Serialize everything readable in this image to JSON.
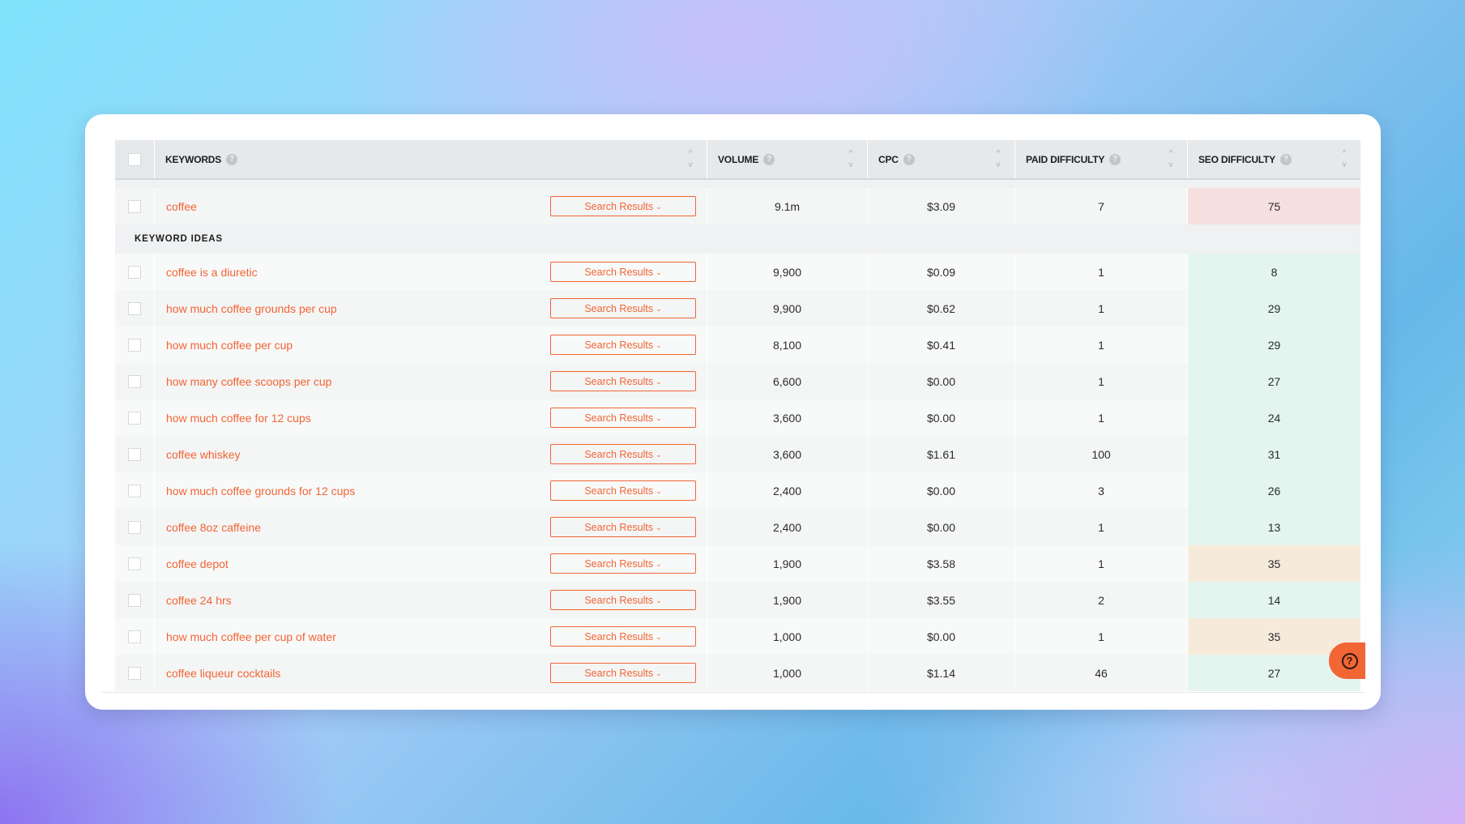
{
  "colors": {
    "accent": "#f26535",
    "seo_green": "#e3f5ee",
    "seo_orange": "#f6eadb",
    "seo_red": "#f6dfdf",
    "header_bg": "#e6e9eb"
  },
  "header": {
    "columns": [
      {
        "label": "KEYWORDS",
        "help_icon": "?",
        "sortable": true
      },
      {
        "label": "VOLUME",
        "help_icon": "?",
        "sortable": true
      },
      {
        "label": "CPC",
        "help_icon": "?",
        "sortable": true
      },
      {
        "label": "PAID DIFFICULTY",
        "help_icon": "?",
        "sortable": true
      },
      {
        "label": "SEO DIFFICULTY",
        "help_icon": "?",
        "sortable": true
      }
    ],
    "sort_up": "^",
    "sort_down": "v"
  },
  "main_keyword": {
    "keyword": "coffee",
    "button": "Search Results",
    "volume": "9.1m",
    "cpc": "$3.09",
    "paid_difficulty": "7",
    "seo_difficulty": "75",
    "seo_level": "red"
  },
  "section_label": "KEYWORD IDEAS",
  "button_label": "Search Results",
  "chevron": "⌄",
  "rows": [
    {
      "keyword": "coffee is a diuretic",
      "volume": "9,900",
      "cpc": "$0.09",
      "paid_difficulty": "1",
      "seo_difficulty": "8",
      "seo_level": "green"
    },
    {
      "keyword": "how much coffee grounds per cup",
      "volume": "9,900",
      "cpc": "$0.62",
      "paid_difficulty": "1",
      "seo_difficulty": "29",
      "seo_level": "green"
    },
    {
      "keyword": "how much coffee per cup",
      "volume": "8,100",
      "cpc": "$0.41",
      "paid_difficulty": "1",
      "seo_difficulty": "29",
      "seo_level": "green"
    },
    {
      "keyword": "how many coffee scoops per cup",
      "volume": "6,600",
      "cpc": "$0.00",
      "paid_difficulty": "1",
      "seo_difficulty": "27",
      "seo_level": "green"
    },
    {
      "keyword": "how much coffee for 12 cups",
      "volume": "3,600",
      "cpc": "$0.00",
      "paid_difficulty": "1",
      "seo_difficulty": "24",
      "seo_level": "green"
    },
    {
      "keyword": "coffee whiskey",
      "volume": "3,600",
      "cpc": "$1.61",
      "paid_difficulty": "100",
      "seo_difficulty": "31",
      "seo_level": "green"
    },
    {
      "keyword": "how much coffee grounds for 12 cups",
      "volume": "2,400",
      "cpc": "$0.00",
      "paid_difficulty": "3",
      "seo_difficulty": "26",
      "seo_level": "green"
    },
    {
      "keyword": "coffee 8oz caffeine",
      "volume": "2,400",
      "cpc": "$0.00",
      "paid_difficulty": "1",
      "seo_difficulty": "13",
      "seo_level": "green"
    },
    {
      "keyword": "coffee depot",
      "volume": "1,900",
      "cpc": "$3.58",
      "paid_difficulty": "1",
      "seo_difficulty": "35",
      "seo_level": "orange"
    },
    {
      "keyword": "coffee 24 hrs",
      "volume": "1,900",
      "cpc": "$3.55",
      "paid_difficulty": "2",
      "seo_difficulty": "14",
      "seo_level": "green"
    },
    {
      "keyword": "how much coffee per cup of water",
      "volume": "1,000",
      "cpc": "$0.00",
      "paid_difficulty": "1",
      "seo_difficulty": "35",
      "seo_level": "orange"
    },
    {
      "keyword": "coffee liqueur cocktails",
      "volume": "1,000",
      "cpc": "$1.14",
      "paid_difficulty": "46",
      "seo_difficulty": "27",
      "seo_level": "green"
    }
  ],
  "help_button": {
    "icon": "?"
  }
}
